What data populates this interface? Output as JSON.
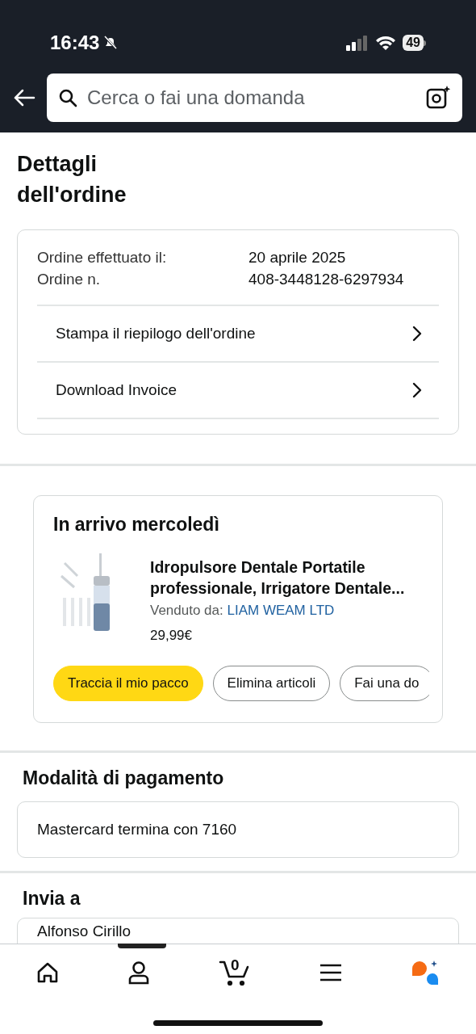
{
  "status_bar": {
    "time": "16:43",
    "battery": "49"
  },
  "search": {
    "placeholder": "Cerca o fai una domanda"
  },
  "title": "Dettagli dell'ordine",
  "order_info": {
    "rows": [
      {
        "label": "Ordine effettuato il:",
        "value": "20 aprile 2025"
      },
      {
        "label": "Ordine n.",
        "value": "408-3448128-6297934"
      }
    ],
    "links": [
      "Stampa il riepilogo dell'ordine",
      "Download Invoice"
    ]
  },
  "delivery": {
    "heading": "In arrivo mercoledì",
    "product": {
      "kind": "picture",
      "name": "Idropulsore Dentale Portatile professionale, Irrigatore Dentale...",
      "sold_by_label": "Venduto da:",
      "seller": "LIAM WEAM LTD",
      "price": "29,99€"
    },
    "actions": [
      {
        "label": "Traccia il mio pacco",
        "kind": "primary"
      },
      {
        "label": "Elimina articoli",
        "kind": "outline"
      },
      {
        "label": "Fai una do",
        "kind": "outline"
      }
    ]
  },
  "payment": {
    "heading": "Modalità di pagamento",
    "method": "Mastercard termina con 7160"
  },
  "ship_to": {
    "heading": "Invia a",
    "name": "Alfonso Cirillo"
  },
  "bottom_nav": {
    "cart_count": "0"
  }
}
